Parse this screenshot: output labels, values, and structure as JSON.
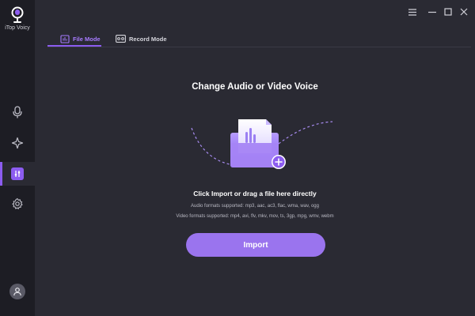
{
  "app": {
    "name": "iTop Voicy"
  },
  "sidebar": {
    "items": [
      {
        "name": "microphone",
        "icon": "microphone-icon"
      },
      {
        "name": "effects",
        "icon": "sparkle-icon"
      },
      {
        "name": "file-mode",
        "icon": "sliders-icon",
        "active": true
      },
      {
        "name": "settings",
        "icon": "gear-icon"
      }
    ],
    "account_icon": "user-icon"
  },
  "titlebar": {
    "buttons": [
      "menu-icon",
      "minimize-icon",
      "maximize-icon",
      "close-icon"
    ]
  },
  "tabs": [
    {
      "label": "File Mode",
      "icon": "file-audio-icon",
      "active": true
    },
    {
      "label": "Record Mode",
      "icon": "tape-icon",
      "active": false
    }
  ],
  "main": {
    "heading": "Change Audio or Video Voice",
    "instruction": "Click Import or drag a file here directly",
    "audio_formats": "Audio formats supported: mp3, aac, ac3, flac, wma, wav, ogg",
    "video_formats": "Video formats supported: mp4, avi, flv, mkv, mov, ts, 3gp, mpg, wmv, webm",
    "import_label": "Import"
  },
  "colors": {
    "accent": "#8c5cf0",
    "button": "#9a74ee",
    "background": "#2a2a33",
    "sidebar": "#1d1d24"
  }
}
